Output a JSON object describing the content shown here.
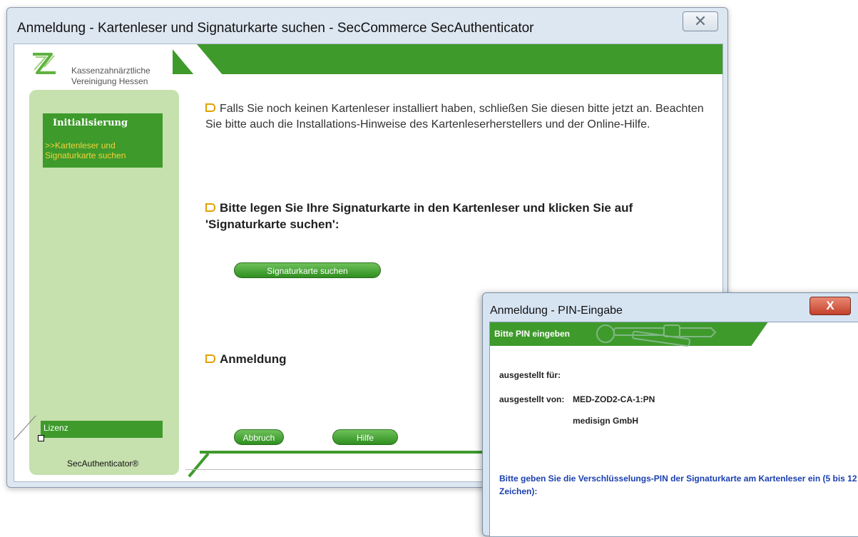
{
  "main_window": {
    "title": "Anmeldung - Kartenleser und Signaturkarte suchen - SecCommerce SecAuthenticator",
    "close_glyph": "✕",
    "logo": {
      "line1": "Kassenzahnärztliche",
      "line2": "Vereinigung Hessen"
    },
    "sidebar": {
      "section_title": "Initialisierung",
      "item_line1": ">>Kartenleser und",
      "item_line2": "Signaturkarte suchen",
      "license_label": "Lizenz"
    },
    "brand": "SecAuthenticator®",
    "content": {
      "info_text": "Falls Sie noch keinen Kartenleser installiert haben, schließen Sie diesen bitte jetzt an. Beachten Sie bitte auch die Installations-Hinweise des Kartenleserherstellers und der Online-Hilfe.",
      "instruction_text": "Bitte legen Sie Ihre Signaturkarte in den Kartenleser und klicken Sie auf 'Signaturkarte suchen':",
      "search_button": "Signaturkarte suchen",
      "login_heading": "Anmeldung",
      "cancel_button": "Abbruch",
      "help_button": "Hilfe"
    }
  },
  "pin_dialog": {
    "title": "Anmeldung - PIN-Eingabe",
    "close_glyph": "X",
    "band_title": "Bitte PIN eingeben",
    "issued_for_label": "ausgestellt für:",
    "issued_by_label": "ausgestellt von:",
    "issued_by_value": "MED-ZOD2-CA-1:PN",
    "issuer_org": "medisign GmbH",
    "instruction": "Bitte geben Sie die Verschlüsselungs-PIN der Signaturkarte am Kartenleser ein (5 bis 12 Zeichen):"
  },
  "colors": {
    "accent_green": "#3f9a2c",
    "sidebar_green": "#c6e0ae",
    "nav_yellow": "#f5d33a",
    "pin_blue": "#1a3fb0"
  }
}
